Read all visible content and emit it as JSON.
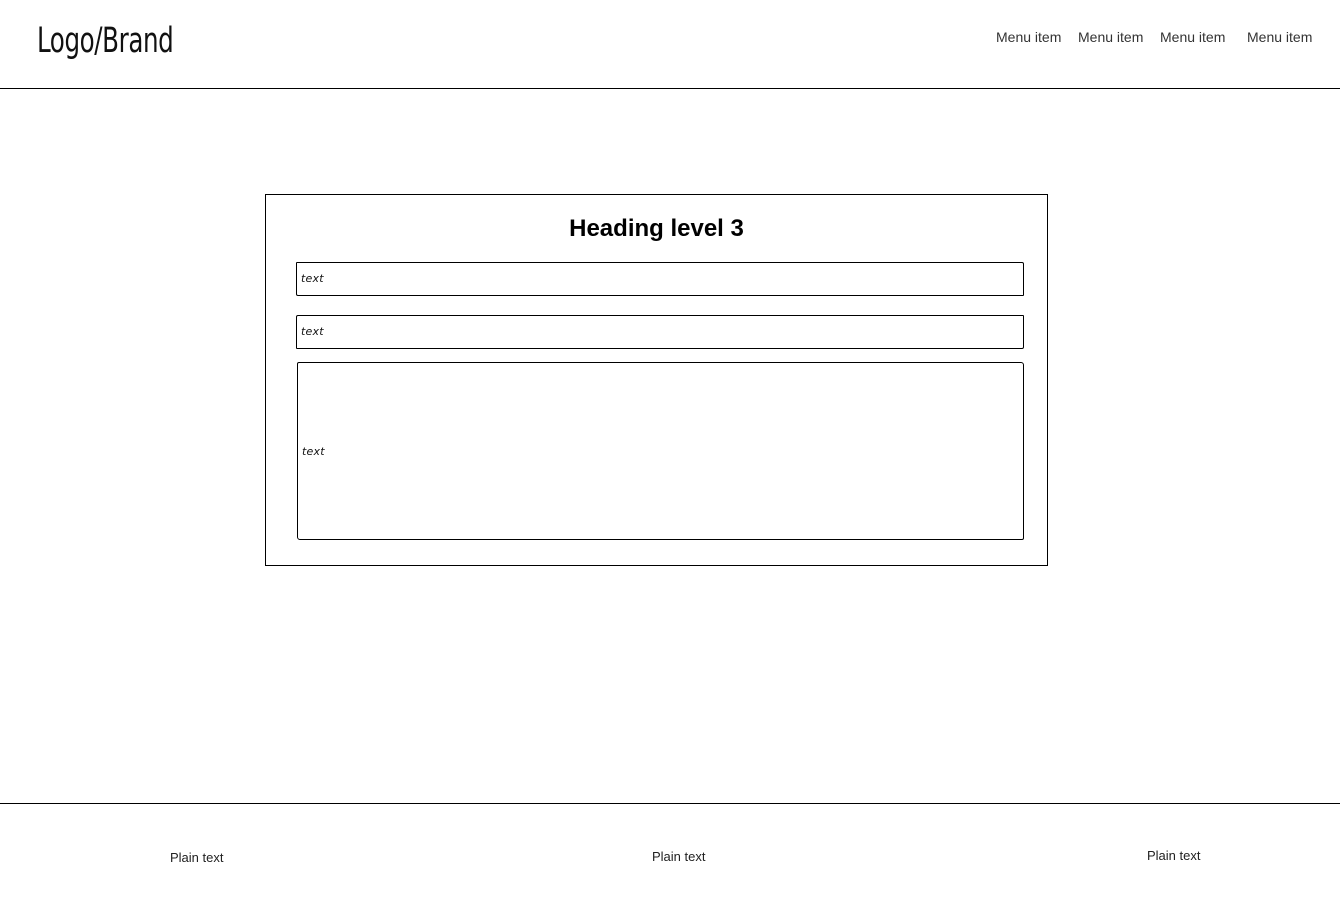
{
  "header": {
    "logo": "Logo/Brand",
    "menu": [
      {
        "label": "Menu item"
      },
      {
        "label": "Menu item"
      },
      {
        "label": "Menu item"
      },
      {
        "label": "Menu item"
      }
    ]
  },
  "form": {
    "heading": "Heading level 3",
    "fields": [
      {
        "value": "text"
      },
      {
        "value": "text"
      },
      {
        "value": "text"
      }
    ]
  },
  "footer": {
    "items": [
      {
        "text": "Plain text"
      },
      {
        "text": "Plain text"
      },
      {
        "text": "Plain text"
      }
    ]
  }
}
